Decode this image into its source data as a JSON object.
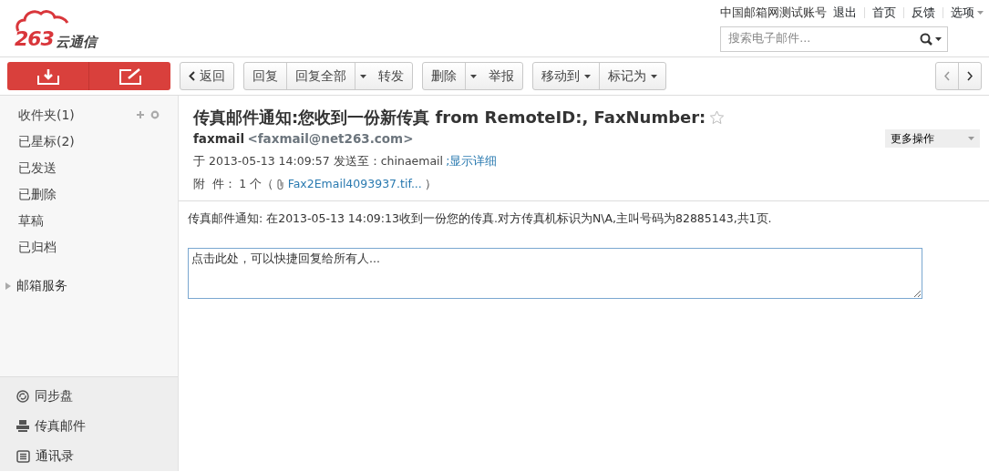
{
  "header": {
    "logo_number": "263",
    "logo_text": "云通信",
    "account": "中国邮箱网测试账号",
    "links": [
      {
        "label": "退出",
        "dropdown": false
      },
      {
        "label": "首页",
        "dropdown": false
      },
      {
        "label": "反馈",
        "dropdown": false
      },
      {
        "label": "选项",
        "dropdown": true
      }
    ],
    "search": {
      "placeholder": "搜索电子邮件..."
    }
  },
  "toolbar": {
    "groups": [
      [
        {
          "label": "返回",
          "kind": "back"
        }
      ],
      [
        {
          "label": "回复",
          "kind": "plain"
        },
        {
          "label": "回复全部",
          "kind": "split"
        },
        {
          "label": "转发",
          "kind": "plain"
        }
      ],
      [
        {
          "label": "删除",
          "kind": "split"
        },
        {
          "label": "举报",
          "kind": "plain"
        }
      ],
      [
        {
          "label": "移动到",
          "kind": "dropdown"
        },
        {
          "label": "标记为",
          "kind": "dropdown"
        }
      ]
    ]
  },
  "sidebar": {
    "folders": [
      {
        "label": "收件夹(1)"
      },
      {
        "label": "已星标(2)"
      },
      {
        "label": "已发送"
      },
      {
        "label": "已删除"
      },
      {
        "label": "草稿"
      },
      {
        "label": "已归档"
      }
    ],
    "services": {
      "label": "邮箱服务",
      "expanded": false
    },
    "apps": [
      {
        "label": "同步盘",
        "kind": "sync"
      },
      {
        "label": "传真邮件",
        "kind": "fax"
      },
      {
        "label": "通讯录",
        "kind": "contacts"
      }
    ]
  },
  "message": {
    "subject": "传真邮件通知:您收到一份新传真 from RemoteID:, FaxNumber:",
    "starred": false,
    "more_actions": "更多操作",
    "sender_name": "faxmail",
    "sender_address": "<faxmail@net263.com>",
    "date_line": "于 2013-05-13 14:09:57 发送至：chinaemail",
    "details_link": ";显示详细",
    "attachment_label": "附  件：",
    "attachment_count": "1 个（",
    "attachment_name": "Fax2Email4093937.tif...",
    "attachment_end": "）",
    "body": "传真邮件通知: 在2013-05-13 14:09:13收到一份您的传真.对方传真机标识为N\\A,主叫号码为82885143,共1页.",
    "reply_placeholder": "点击此处，可以快捷回复给所有人..."
  }
}
